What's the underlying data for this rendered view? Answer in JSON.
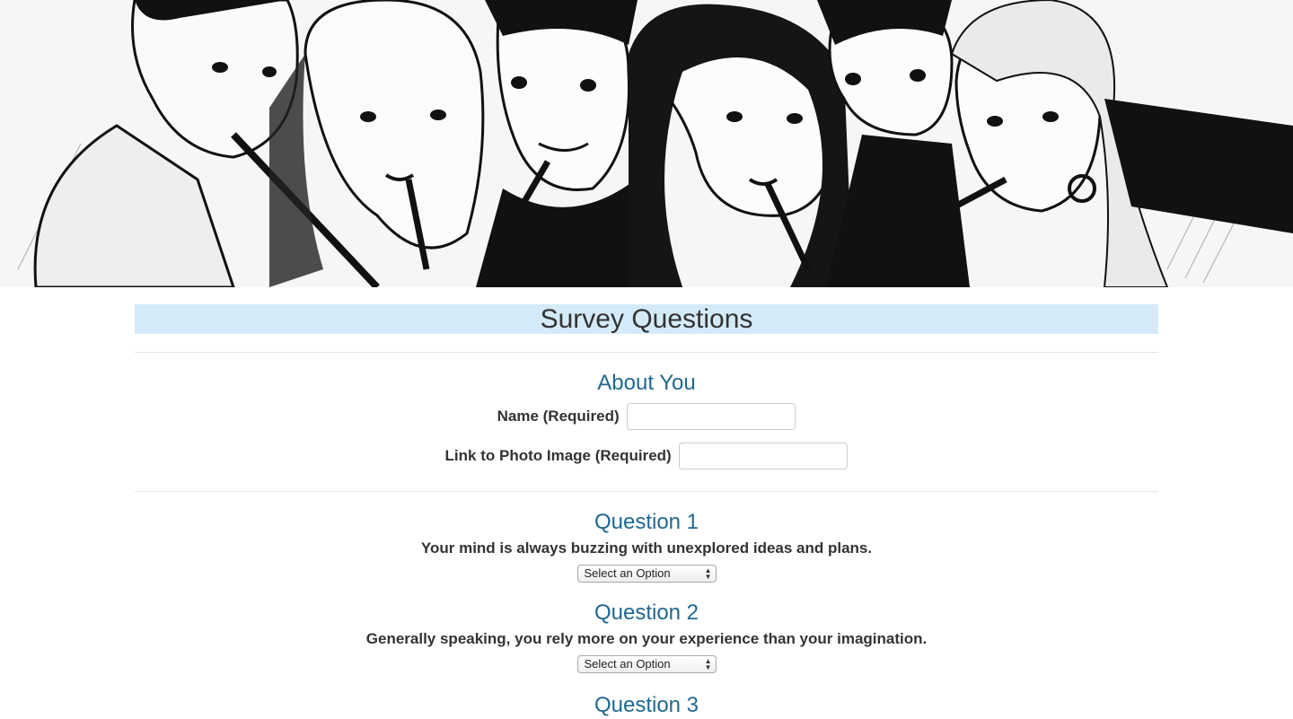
{
  "hero": {
    "image_alt": "Friends sketch"
  },
  "survey": {
    "title": "Survey Questions",
    "about": {
      "heading": "About You",
      "name_label": "Name (Required)",
      "name_value": "",
      "photo_label": "Link to Photo Image (Required)",
      "photo_value": ""
    },
    "questions": [
      {
        "heading": "Question 1",
        "text": "Your mind is always buzzing with unexplored ideas and plans.",
        "selected": "Select an Option"
      },
      {
        "heading": "Question 2",
        "text": "Generally speaking, you rely more on your experience than your imagination.",
        "selected": "Select an Option"
      },
      {
        "heading": "Question 3",
        "text": "",
        "selected": ""
      }
    ]
  },
  "colors": {
    "title_bg": "#d4eaf8",
    "heading": "#21688f",
    "text": "#333333"
  }
}
